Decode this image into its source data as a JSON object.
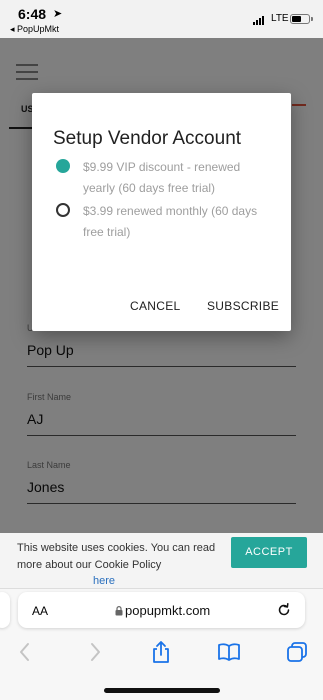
{
  "status_bar": {
    "time": "6:48",
    "back_app": "◂ PopUpMkt",
    "network": "LTE",
    "battery_level": 0.55
  },
  "page": {
    "tab_label": "US",
    "fields": [
      {
        "label": "Username",
        "value": "Pop Up"
      },
      {
        "label": "First Name",
        "value": "AJ"
      },
      {
        "label": "Last Name",
        "value": "Jones"
      }
    ]
  },
  "dialog": {
    "title": "Setup Vendor Account",
    "options": [
      {
        "label": "$9.99 VIP discount - renewed yearly (60 days free trial)",
        "checked": true
      },
      {
        "label": "$3.99 renewed monthly (60 days free trial)",
        "checked": false
      }
    ],
    "cancel_label": "CANCEL",
    "subscribe_label": "SUBSCRIBE"
  },
  "cookie_banner": {
    "text": "This website uses cookies. You can read more about our Cookie Policy",
    "link": "here",
    "accept_label": "ACCEPT"
  },
  "browser": {
    "aa_label": "AA",
    "url": "popupmkt.com"
  },
  "colors": {
    "accent": "#26a69a",
    "link": "#2a6fbd"
  }
}
